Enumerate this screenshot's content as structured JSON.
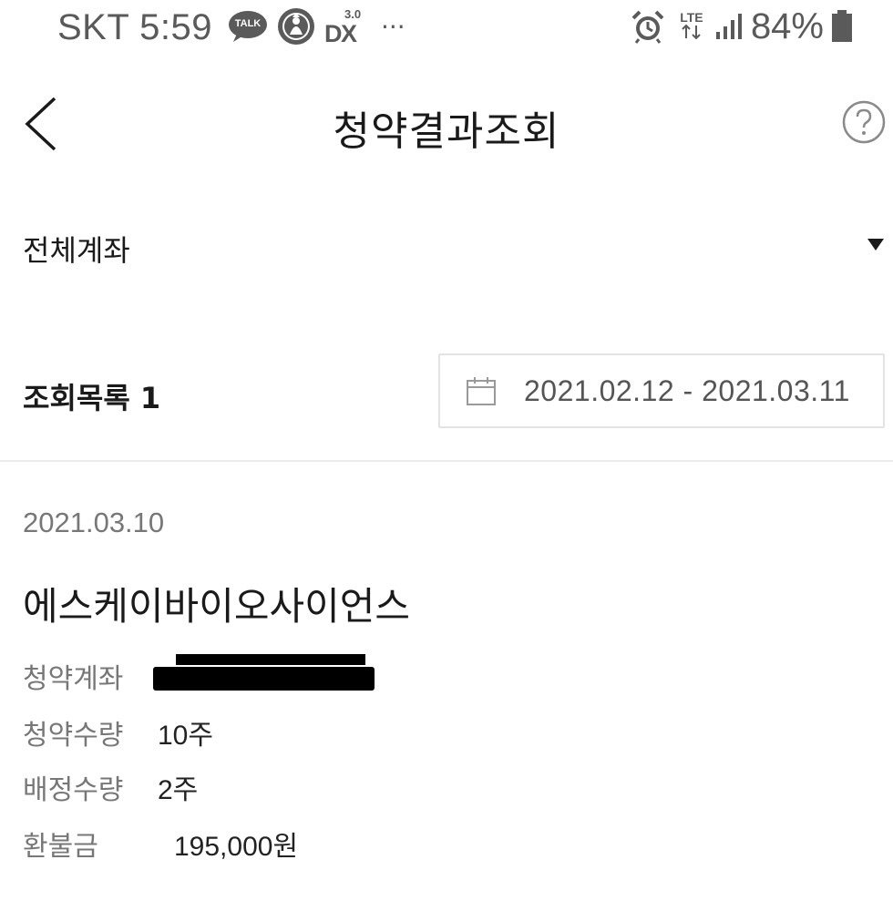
{
  "status_bar": {
    "carrier_time": "SKT 5:59",
    "notif_icons": [
      "talk-icon",
      "starbucks-icon",
      "dx-icon",
      "more-icon"
    ],
    "dx_badge": "3.0",
    "talk_label": "TALK",
    "more_label": "···",
    "lte_label": "LTE",
    "battery": "84%"
  },
  "header": {
    "title": "청약결과조회"
  },
  "account_selector": {
    "label": "전체계좌"
  },
  "list_header": {
    "count_label": "조회목록 1",
    "date_range": "2021.02.12 - 2021.03.11"
  },
  "results": [
    {
      "date": "2021.03.10",
      "company": "에스케이바이오사이언스",
      "account_label": "청약계좌",
      "quantity_label": "청약수량",
      "quantity_value": "10주",
      "allocated_label": "배정수량",
      "allocated_value": "2주",
      "refund_label": "환불금",
      "refund_value": "195,000원"
    }
  ],
  "colors": {
    "text_primary": "#1a1a1a",
    "text_secondary": "#777777",
    "border": "#e3e3e3",
    "status_icons": "#5a5a5a"
  }
}
